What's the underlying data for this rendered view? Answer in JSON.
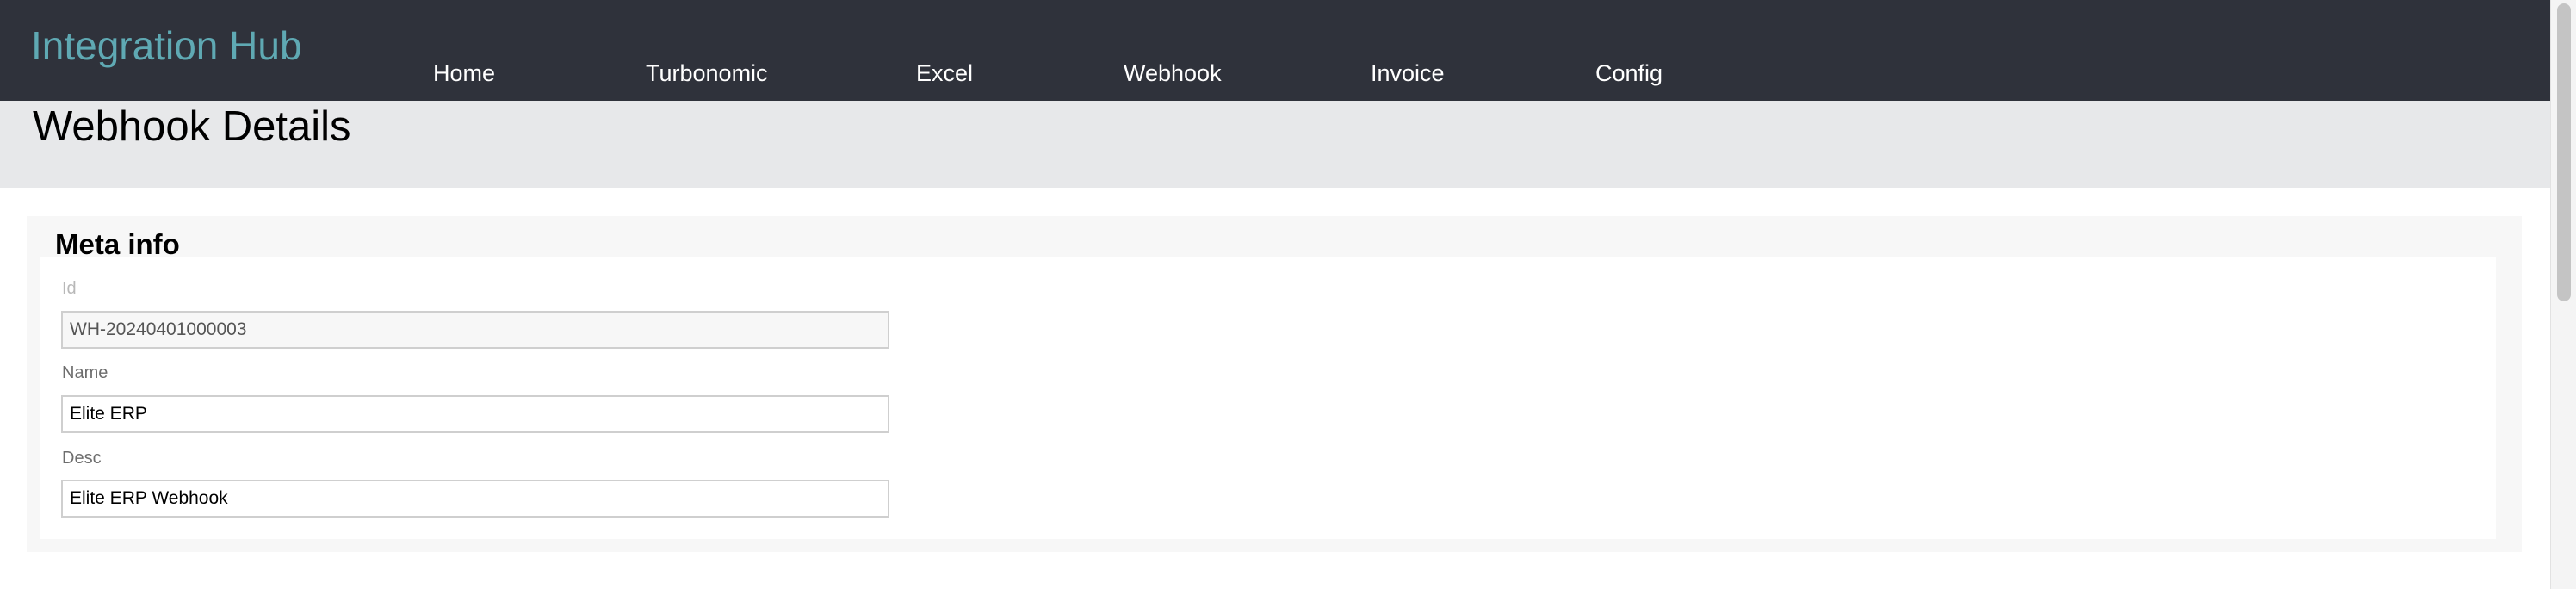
{
  "app": {
    "title": "Integration Hub"
  },
  "nav": {
    "items": [
      {
        "label": "Home"
      },
      {
        "label": "Turbonomic"
      },
      {
        "label": "Excel"
      },
      {
        "label": "Webhook"
      },
      {
        "label": "Invoice"
      },
      {
        "label": "Config"
      }
    ]
  },
  "page": {
    "title": "Webhook Details"
  },
  "meta": {
    "heading": "Meta info",
    "fields": {
      "id": {
        "label": "Id",
        "value": "WH-20240401000003"
      },
      "name": {
        "label": "Name",
        "value": "Elite ERP"
      },
      "desc": {
        "label": "Desc",
        "value": "Elite ERP Webhook"
      }
    }
  },
  "colors": {
    "topbar": "#2f323b",
    "brand": "#5fa9b3",
    "title_band": "#e7e8ea"
  }
}
